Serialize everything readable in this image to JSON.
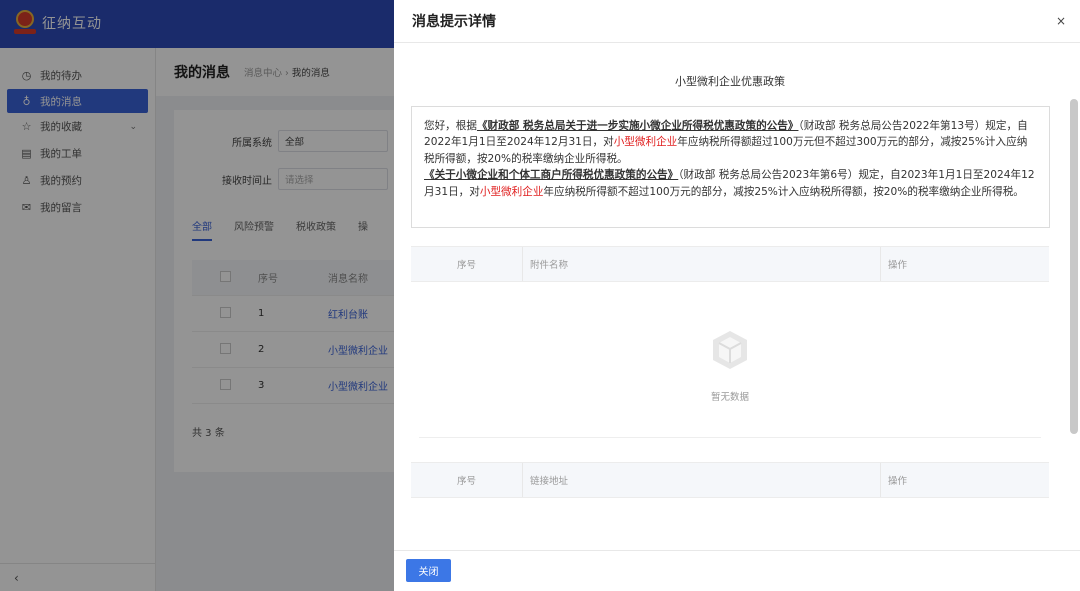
{
  "app": {
    "name": "征纳互动"
  },
  "sidebar": {
    "items": [
      {
        "label": "我的待办",
        "icon": "clock-icon"
      },
      {
        "label": "我的消息",
        "icon": "bulb-icon",
        "active": true
      },
      {
        "label": "我的收藏",
        "icon": "star-icon",
        "has_arrow": true
      },
      {
        "label": "我的工单",
        "icon": "ticket-icon"
      },
      {
        "label": "我的预约",
        "icon": "person-icon"
      },
      {
        "label": "我的留言",
        "icon": "mail-icon"
      }
    ],
    "collapse_glyph": "‹"
  },
  "page": {
    "title": "我的消息",
    "breadcrumb": {
      "parent": "消息中心",
      "sep": "›",
      "current": "我的消息"
    }
  },
  "filters": {
    "system_label": "所属系统",
    "system_value": "全部",
    "time_label": "接收时间止",
    "time_placeholder": "请选择"
  },
  "tabs": [
    "全部",
    "风险预警",
    "税收政策",
    "操"
  ],
  "list": {
    "headers": {
      "no": "序号",
      "name": "消息名称"
    },
    "rows": [
      {
        "no": "1",
        "name": "红利台账"
      },
      {
        "no": "2",
        "name": "小型微利企业"
      },
      {
        "no": "3",
        "name": "小型微利企业"
      }
    ],
    "total": "共 3 条"
  },
  "drawer": {
    "title": "消息提示详情",
    "close_glyph": "×",
    "notice_title": "小型微利企业优惠政策",
    "notice": {
      "p1_a": "您好，根据",
      "p1_link": "《财政部 税务总局关于进一步实施小微企业所得税优惠政策的公告》",
      "p1_b": "（财政部 税务总局公告2022年第13号）规定，自2022年1月1日至2024年12月31日，对",
      "p1_red": "小型微利企业",
      "p1_c": "年应纳税所得额超过100万元但不超过300万元的部分，减按25%计入应纳税所得额，按20%的税率缴纳企业所得税。",
      "p2_link": "《关于小微企业和个体工商户所得税优惠政策的公告》",
      "p2_a": "（财政部 税务总局公告2023年第6号）规定，自2023年1月1日至2024年12月31日，对",
      "p2_red": "小型微利企业",
      "p2_b": "年应纳税所得额不超过100万元的部分，减按25%计入应纳税所得额，按20%的税率缴纳企业所得税。"
    },
    "attachments": {
      "col_no": "序号",
      "col_name": "附件名称",
      "col_op": "操作",
      "empty_text": "暂无数据"
    },
    "links": {
      "col_no": "序号",
      "col_name": "链接地址",
      "col_op": "操作"
    },
    "close_button": "关闭"
  },
  "colors": {
    "brand": "#2e4bb8",
    "accent": "#3a62d8",
    "highlight_red": "#e02020",
    "button": "#3c77e6"
  }
}
